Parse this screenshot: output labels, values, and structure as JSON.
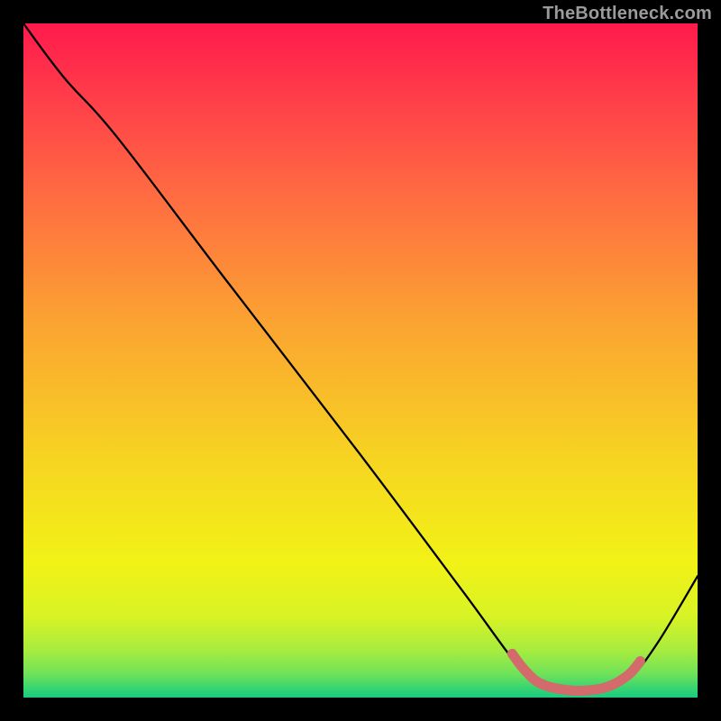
{
  "watermark": "TheBottleneck.com",
  "chart_data": {
    "type": "line",
    "title": "",
    "xlabel": "",
    "ylabel": "",
    "xlim": [
      0,
      100
    ],
    "ylim": [
      0,
      100
    ],
    "grid": false,
    "legend": false,
    "annotations": [],
    "series": [
      {
        "name": "bottleneck-curve",
        "color": "#000000",
        "x": [
          0,
          6,
          14,
          30,
          50,
          65,
          74,
          78,
          82,
          86,
          90,
          94,
          100
        ],
        "y": [
          100,
          92,
          83,
          62,
          36,
          16,
          4,
          1.5,
          1,
          1.2,
          3,
          8,
          18
        ]
      },
      {
        "name": "optimal-band-markers",
        "color": "#d36a6c",
        "x": [
          72.5,
          74,
          76,
          78,
          80,
          82,
          84,
          86,
          88,
          90,
          91.5
        ],
        "y": [
          6.5,
          4.5,
          2.5,
          1.6,
          1.2,
          1.0,
          1.1,
          1.4,
          2.2,
          3.6,
          5.4
        ]
      }
    ],
    "background_gradient_stops": [
      {
        "offset": 0.0,
        "color": "#ff1a4c"
      },
      {
        "offset": 0.1,
        "color": "#ff3a4a"
      },
      {
        "offset": 0.25,
        "color": "#ff6a42"
      },
      {
        "offset": 0.45,
        "color": "#fba531"
      },
      {
        "offset": 0.65,
        "color": "#f6d521"
      },
      {
        "offset": 0.8,
        "color": "#f2f217"
      },
      {
        "offset": 0.88,
        "color": "#d8f325"
      },
      {
        "offset": 0.93,
        "color": "#a7ec3f"
      },
      {
        "offset": 0.965,
        "color": "#6fe259"
      },
      {
        "offset": 0.985,
        "color": "#3ad571"
      },
      {
        "offset": 1.0,
        "color": "#17cc82"
      }
    ]
  }
}
